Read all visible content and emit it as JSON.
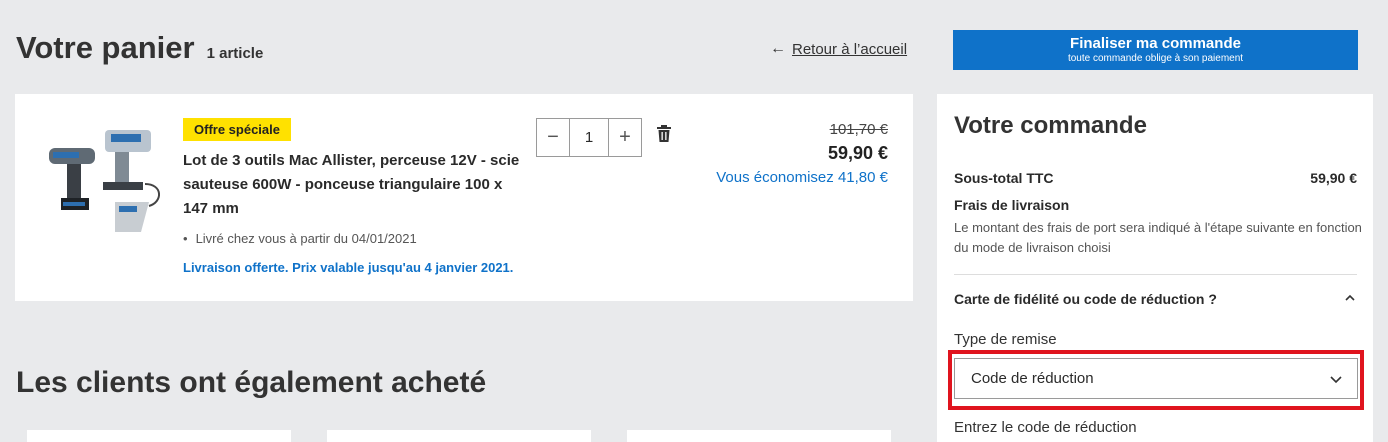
{
  "cart": {
    "title": "Votre panier",
    "count": "1 article",
    "back_link": "Retour à l’accueil"
  },
  "checkout": {
    "label": "Finaliser ma commande",
    "sublabel": "toute commande oblige à son paiement"
  },
  "product": {
    "badge": "Offre spéciale",
    "name": "Lot de 3 outils Mac Allister, perceuse 12V - scie sauteuse 600W - ponceuse triangulaire 100 x 147 mm",
    "delivery": "Livré chez vous à partir du 04/01/2021",
    "promo": "Livraison offerte. Prix valable jusqu'au 4 janvier 2021.",
    "quantity": "1",
    "old_price": "101,70 €",
    "price": "59,90 €",
    "savings": "Vous économisez 41,80 €"
  },
  "recommendations": {
    "title": "Les clients ont également acheté"
  },
  "order": {
    "title": "Votre commande",
    "subtotal_label": "Sous-total TTC",
    "subtotal_value": "59,90 €",
    "shipping_title": "Frais de livraison",
    "shipping_note": "Le montant des frais de port sera indiqué à l'étape suivante en fonction du mode de livraison choisi",
    "fidelity_label": "Carte de fidélité ou code de réduction ?",
    "discount_type_label": "Type de remise",
    "discount_type_value": "Code de réduction",
    "enter_code_label": "Entrez le code de réduction"
  },
  "colors": {
    "accent": "#0f72c9",
    "badge": "#ffe100",
    "highlight": "#e0141e"
  }
}
